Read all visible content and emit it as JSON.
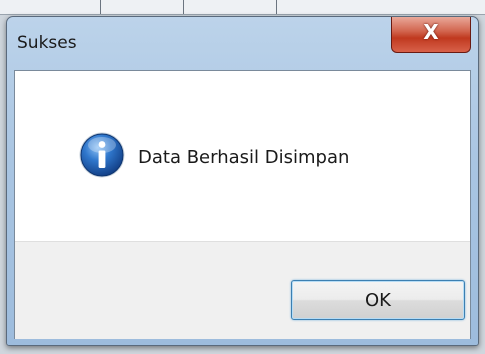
{
  "dialog": {
    "title": "Sukses",
    "close_glyph": "X",
    "message": "Data Berhasil Disimpan",
    "icon": "info-icon",
    "ok_label": "OK"
  },
  "colors": {
    "frame": "#a9c5e2",
    "close_button": "#c0391f",
    "info_icon": "#1f5fb5",
    "button_focus": "#3c7fb1"
  }
}
